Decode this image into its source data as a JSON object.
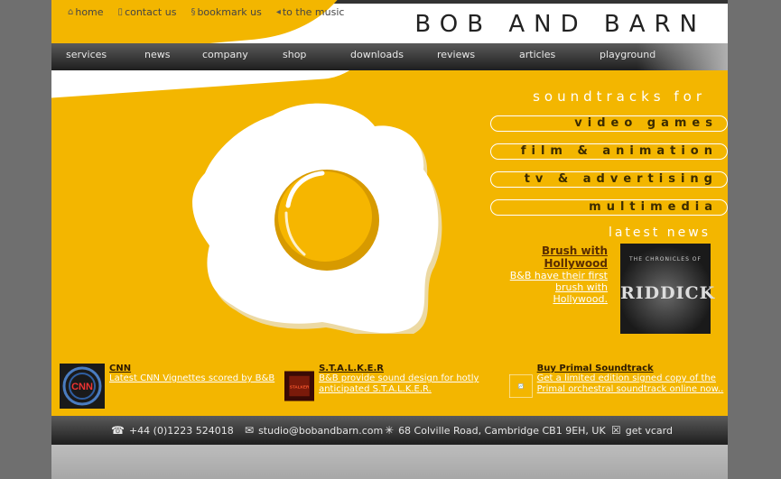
{
  "toplinks": [
    {
      "icon": "home-icon",
      "label": "home"
    },
    {
      "icon": "contact-icon",
      "label": "contact us"
    },
    {
      "icon": "bookmark-icon",
      "label": "bookmark us"
    },
    {
      "icon": "speaker-icon",
      "label": "to the music"
    }
  ],
  "logo": "BOB AND BARN",
  "nav": [
    "services",
    "news",
    "company",
    "shop",
    "downloads",
    "reviews",
    "articles",
    "playground"
  ],
  "soundtracks_title": "soundtracks for",
  "categories": [
    "video games",
    "film & animation",
    "tv & advertising",
    "multimedia"
  ],
  "latest_news_title": "latest news",
  "news": {
    "headline": "Brush with Hollywood",
    "description": "B&B have their first brush with Hollywood.",
    "image_top": "THE CHRONICLES OF",
    "image_title": "RIDDICK"
  },
  "promos": [
    {
      "thumb_text": "CNN",
      "title": "CNN",
      "description": "Latest CNN Vignettes scored by B&B"
    },
    {
      "thumb_text": "STALKER",
      "title": "S.T.A.L.K.E.R",
      "description": "B&B provide sound design for hotly anticipated S.T.A.L.K.E.R."
    },
    {
      "thumb_text": "",
      "title": "Buy Primal Soundtrack",
      "description": "Get a limited edition signed copy of the Primal orchestral soundtrack online now.."
    }
  ],
  "footer": {
    "phone": "+44 (0)1223 524018",
    "email": "studio@bobandbarn.com",
    "address": "68 Colville Road, Cambridge CB1 9EH, UK",
    "vcard": "get vcard"
  },
  "colors": {
    "accent": "#f3b600",
    "nav_bg": "#2a2a2a",
    "page_bg": "#6f6f6f"
  }
}
